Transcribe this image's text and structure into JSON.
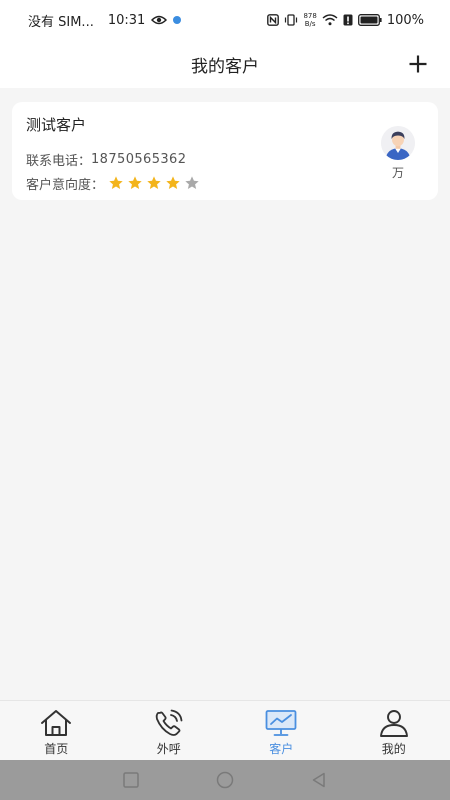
{
  "status_bar": {
    "carrier": "没有 SIM...",
    "time": "10:31",
    "net_speed_value": "878",
    "net_speed_unit": "B/s",
    "battery": "100%"
  },
  "header": {
    "title": "我的客户",
    "add_icon": "plus-icon"
  },
  "customers": [
    {
      "name": "测试客户",
      "phone_label": "联系电话：",
      "phone": "18750565362",
      "intention_label": "客户意向度：",
      "rating": 4,
      "rating_max": 5,
      "owner_name": "万",
      "avatar_icon": "person-avatar"
    }
  ],
  "tabs": [
    {
      "label": "首页",
      "icon": "home-icon",
      "active": false
    },
    {
      "label": "外呼",
      "icon": "phone-call-icon",
      "active": false
    },
    {
      "label": "客户",
      "icon": "monitor-chart-icon",
      "active": true
    },
    {
      "label": "我的",
      "icon": "user-icon",
      "active": false
    }
  ],
  "colors": {
    "accent": "#4a8fe0",
    "star_filled": "#f3b41b",
    "star_empty": "#a9a9a9"
  }
}
